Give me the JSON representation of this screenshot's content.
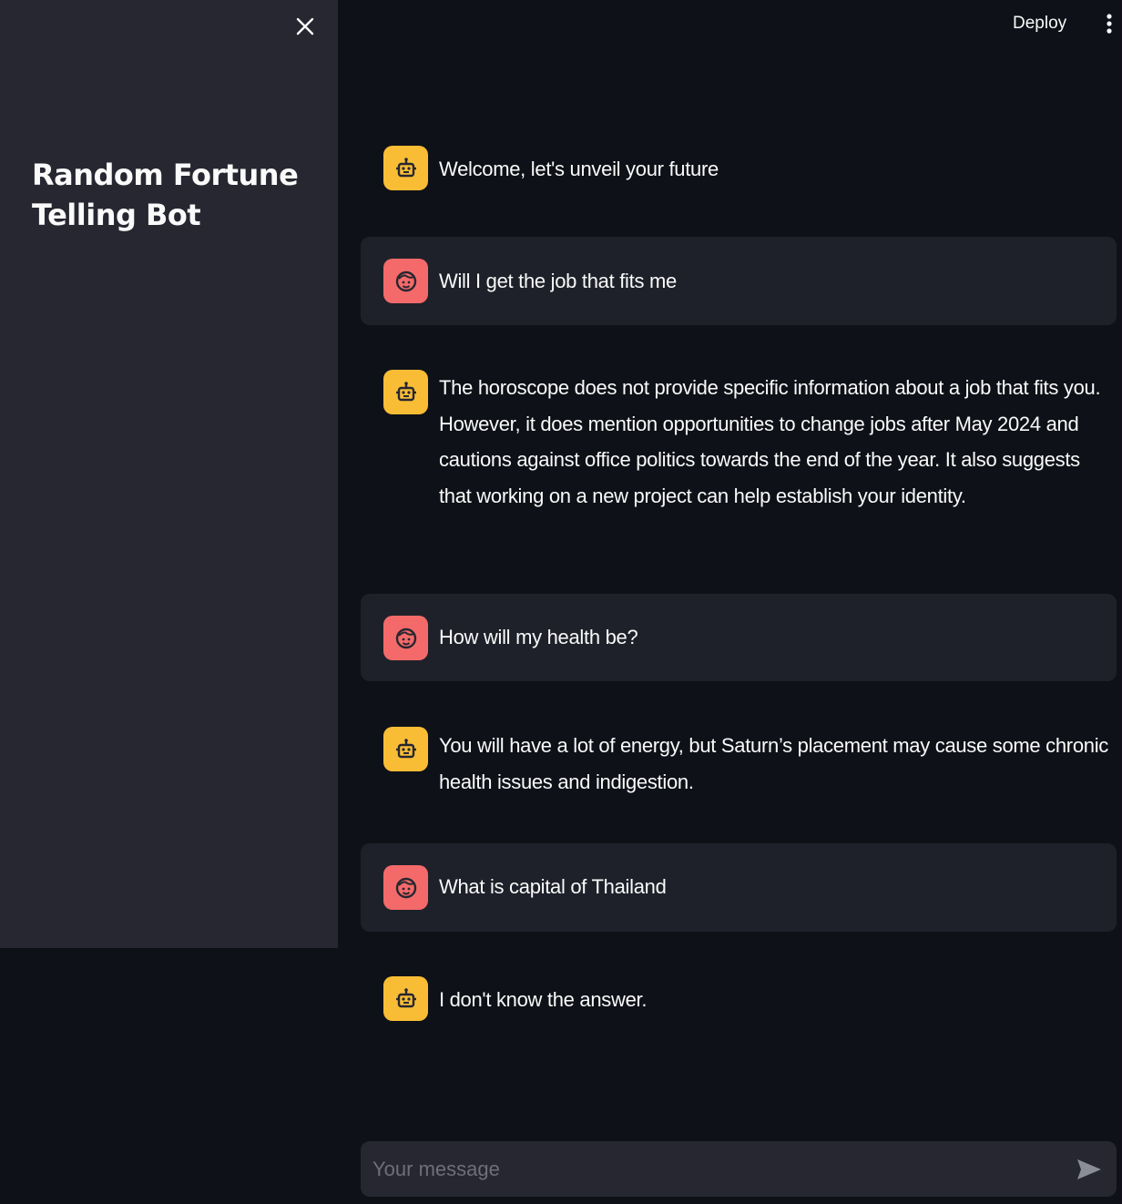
{
  "sidebar": {
    "title": "Random Fortune Telling Bot",
    "close_icon": "close-icon"
  },
  "header": {
    "deploy_label": "Deploy",
    "menu_icon": "more-vertical-icon"
  },
  "messages": [
    {
      "role": "assistant",
      "avatar_icon": "robot-icon",
      "text": "Welcome, let's unveil your future"
    },
    {
      "role": "user",
      "avatar_icon": "face-icon",
      "text": "Will I get the job that fits me"
    },
    {
      "role": "assistant",
      "avatar_icon": "robot-icon",
      "text": "The horoscope does not provide specific information about a job that fits you. However, it does mention opportunities to change jobs after May 2024 and cautions against office politics towards the end of the year. It also suggests that working on a new project can help establish your identity."
    },
    {
      "role": "user",
      "avatar_icon": "face-icon",
      "text": "How will my health be?"
    },
    {
      "role": "assistant",
      "avatar_icon": "robot-icon",
      "text": "You will have a lot of energy, but Saturn’s placement may cause some chronic health issues and indigestion."
    },
    {
      "role": "user",
      "avatar_icon": "face-icon",
      "text": "What is capital of Thailand"
    },
    {
      "role": "assistant",
      "avatar_icon": "robot-icon",
      "text": "I don't know the answer."
    }
  ],
  "chat_input": {
    "placeholder": "Your message",
    "value": "",
    "send_icon": "send-icon"
  },
  "colors": {
    "background": "#0e1117",
    "sidebar": "#262730",
    "user_message_bg": "#1f212a",
    "bot_avatar": "#f9bd35",
    "user_avatar": "#f46a6a",
    "text": "#fafafa"
  }
}
